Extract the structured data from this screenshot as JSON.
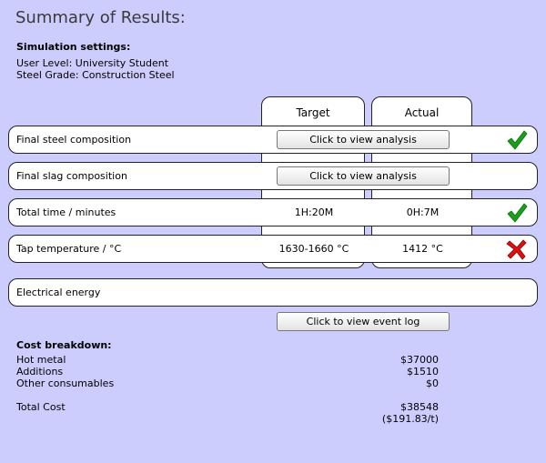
{
  "page": {
    "title": "Summary of Results:"
  },
  "settings": {
    "header": "Simulation settings:",
    "user_level": "User Level: University Student",
    "steel_grade": "Steel Grade: Construction Steel"
  },
  "columns": {
    "target": "Target",
    "actual": "Actual"
  },
  "rows": {
    "steel": {
      "label": "Final steel composition",
      "button": "Click to view analysis",
      "status": "check-icon"
    },
    "slag": {
      "label": "Final slag composition",
      "button": "Click to view analysis"
    },
    "time": {
      "label": "Total time / minutes",
      "target": "1H:20M",
      "actual": "0H:7M",
      "status": "check-icon"
    },
    "temp": {
      "label": "Tap temperature / °C",
      "target": "1630-1660 °C",
      "actual": "1412 °C",
      "status": "cross-icon"
    },
    "energy": {
      "label": "Electrical energy"
    }
  },
  "event_log_button": "Click to view event log",
  "cost": {
    "header": "Cost breakdown:",
    "items": [
      {
        "label": "Hot metal",
        "value": "$37000"
      },
      {
        "label": "Additions",
        "value": "$1510"
      },
      {
        "label": "Other consumables",
        "value": "$0"
      }
    ],
    "total_label": "Total Cost",
    "total_value": "$38548",
    "per_tonne": "($191.83/t)"
  },
  "colors": {
    "background": "#cccdfd",
    "check": "#1aa01a",
    "cross": "#e01010"
  }
}
